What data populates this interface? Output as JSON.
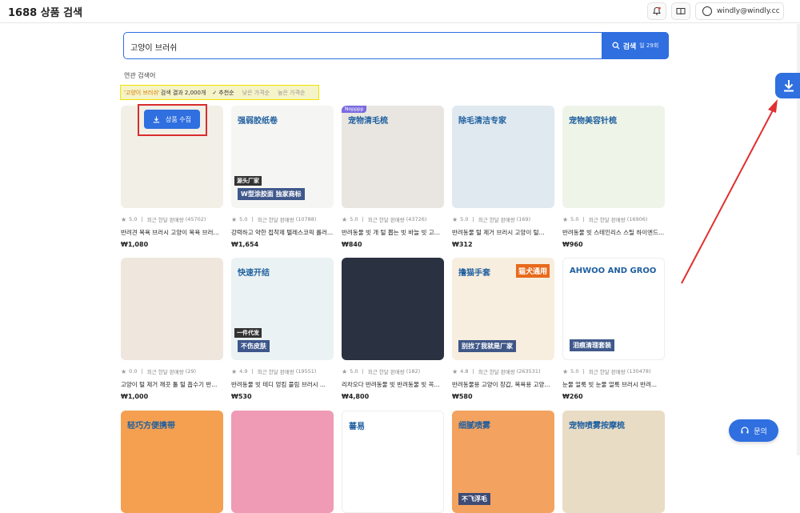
{
  "header": {
    "app_title": "1688 상품 검색",
    "account": "windly@windly.cc",
    "icons": [
      "notification-icon",
      "book-icon",
      "user-icon"
    ]
  },
  "search": {
    "value": "고양이 브러쉬",
    "button_label": "검색",
    "remaining": "일 29회"
  },
  "related_label": "연관 검색어",
  "filter": {
    "keyword": "'고양이 브러쉬'",
    "result_text": "검색 결과 2,000개",
    "options": [
      {
        "label": "추천순",
        "active": true
      },
      {
        "label": "낮은 가격순",
        "active": false
      },
      {
        "label": "높은 가격순",
        "active": false
      }
    ]
  },
  "collect_button_label": "상품 수집",
  "sales_label": "최근 한달 판매량",
  "products": [
    {
      "rating": "5.0",
      "sales": "(45702)",
      "title": "반려견 목욕 브러시 고양이 목욕 브러시...",
      "price": "₩1,080",
      "thumb_bg": "#f1efe6"
    },
    {
      "rating": "5.0",
      "sales": "(10788)",
      "title": "강력하고 약한 접착제 텔레스코픽 롤러...",
      "price": "₩1,654",
      "thumb_bg": "#f5f5f3",
      "cn_top": "强弱胶纸卷",
      "cn_bottom": "W型涂胶面 独家商标",
      "cn_left": "源头厂家"
    },
    {
      "rating": "5.0",
      "sales": "(43726)",
      "title": "반려동물 빗 개 털 뽑는 빗 바늘 빗 고...",
      "price": "₩840",
      "thumb_bg": "#e9e6e1",
      "tag": "Nopppp",
      "cn_top": "宠物清毛梳"
    },
    {
      "rating": "5.0",
      "sales": "(169)",
      "title": "반려동물 털 제거 브러시 고양이 털...",
      "price": "₩312",
      "thumb_bg": "#dfe9ef",
      "cn_top": "除毛清洁专家"
    },
    {
      "rating": "5.0",
      "sales": "(16906)",
      "title": "반려동물 빗 스테인리스 스틸 하이엔드...",
      "price": "₩960",
      "thumb_bg": "#eef5e8",
      "cn_top": "宠物美容针梳"
    },
    {
      "rating": "0.0",
      "sales": "(29)",
      "title": "고양이 털 제거 깨끗 툴 털 흡수기 반...",
      "price": "₩1,000",
      "thumb_bg": "#efe6dd"
    },
    {
      "rating": "4.9",
      "sales": "(19551)",
      "title": "반려동물 빗 테디 엉킴 풀림 브러시 ...",
      "price": "₩530",
      "thumb_bg": "#eaf2f3",
      "cn_top": "快速开结",
      "cn_bottom": "不伤皮肤",
      "cn_left": "一件代发"
    },
    {
      "rating": "5.0",
      "sales": "(182)",
      "title": "리차오다 반려동물 빗 반려동물 빗 꼭...",
      "price": "₩4,800",
      "thumb_bg": "#2a3140"
    },
    {
      "rating": "4.8",
      "sales": "(263531)",
      "title": "반려동물용 고양이 장갑, 목욕용 고양...",
      "price": "₩580",
      "thumb_bg": "#f7eedf",
      "cn_top": "撸猫手套",
      "cn_right": "猫犬通用",
      "cn_bottom": "别找了我就是厂家"
    },
    {
      "rating": "5.0",
      "sales": "(130478)",
      "title": "눈물 얼룩 빗 눈물 얼룩 브러시 반려...",
      "price": "₩260",
      "thumb_bg": "#ffffff",
      "cn_top": "AHWOO AND GROO",
      "cn_bottom": "泪痕清理套装"
    },
    {
      "rating": "",
      "sales": "",
      "title": "",
      "price": "",
      "thumb_bg": "#f4a050",
      "cn_top": "轻巧方便携带"
    },
    {
      "rating": "",
      "sales": "",
      "title": "",
      "price": "",
      "thumb_bg": "#ef9bb6"
    },
    {
      "rating": "",
      "sales": "",
      "title": "",
      "price": "",
      "thumb_bg": "#ffffff",
      "cn_top": "蕃易"
    },
    {
      "rating": "",
      "sales": "",
      "title": "",
      "price": "",
      "thumb_bg": "#f3a25f",
      "cn_top": "细腻喷雾",
      "cn_bottom": "不飞浮毛"
    },
    {
      "rating": "",
      "sales": "",
      "title": "",
      "price": "",
      "thumb_bg": "#e9dcc5",
      "cn_top": "宠物喷雾按摩梳"
    }
  ],
  "chat_label": "문의",
  "colors": {
    "primary": "#2f6fe0",
    "highlight_red": "#d92d2d",
    "filter_bg": "#f5f3c8",
    "keyword_orange": "#d87b00"
  }
}
